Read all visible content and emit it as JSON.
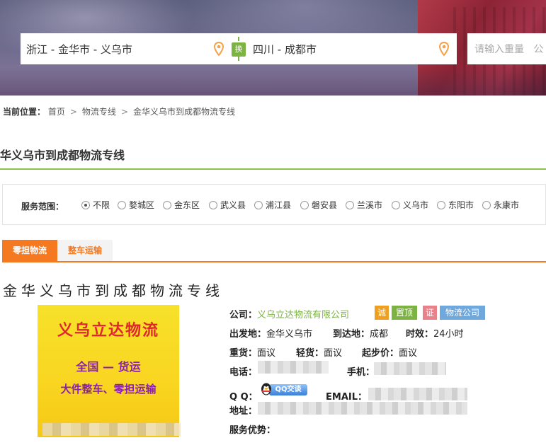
{
  "search": {
    "from": "浙江 - 金华市 - 义乌市",
    "swap_label": "换",
    "to": "四川 - 成都市",
    "weight_placeholder": "请输入重量",
    "weight_unit_partial": "公"
  },
  "breadcrumb": {
    "label": "当前位置：",
    "items": [
      "首页",
      "物流专线",
      "金华义乌市到成都物流专线"
    ],
    "separator": ">"
  },
  "page_title": "华义乌市到成都物流专线",
  "filter": {
    "label": "服务范围：",
    "options": [
      {
        "label": "不限",
        "selected": true
      },
      {
        "label": "婺城区",
        "selected": false
      },
      {
        "label": "金东区",
        "selected": false
      },
      {
        "label": "武义县",
        "selected": false
      },
      {
        "label": "浦江县",
        "selected": false
      },
      {
        "label": "磐安县",
        "selected": false
      },
      {
        "label": "兰溪市",
        "selected": false
      },
      {
        "label": "义乌市",
        "selected": false
      },
      {
        "label": "东阳市",
        "selected": false
      },
      {
        "label": "永康市",
        "selected": false
      }
    ]
  },
  "tabs": [
    {
      "label": "零担物流",
      "active": true
    },
    {
      "label": "整车运输",
      "active": false
    }
  ],
  "line_title": "金华义乌市到成都物流专线",
  "company_image": {
    "line1": "义乌立达物流",
    "line2": "全国 — 货运",
    "line3": "大件整车、零担运输"
  },
  "info": {
    "company_label": "公司：",
    "company_name": "义乌立达物流有限公司",
    "badges": [
      "诚",
      "置顶",
      "证",
      "物流公司"
    ],
    "origin_label": "出发地：",
    "origin": "金华义乌市",
    "dest_label": "到达地：",
    "dest": "成都",
    "time_label": "时效：",
    "time": "24小时",
    "heavy_label": "重货：",
    "heavy": "面议",
    "light_label": "轻货：",
    "light": "面议",
    "start_label": "起步价：",
    "start": "面议",
    "phone_label": "电话：",
    "mobile_label": "手机：",
    "qq_label": "Q Q：",
    "qq_button": "QQ交谈",
    "email_label": "EMAIL：",
    "address_label": "地址：",
    "advantage_label": "服务优势："
  },
  "colors": {
    "accent_orange": "#f47920",
    "accent_green": "#7cb342",
    "badge_blue": "#6fa8dc"
  }
}
